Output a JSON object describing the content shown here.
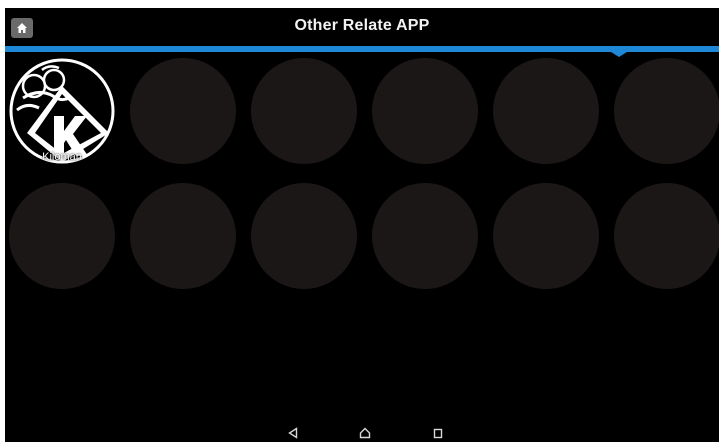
{
  "header": {
    "title": "Other Relate APP",
    "home_icon": "home-icon"
  },
  "apps": [
    {
      "label": "Kiloman",
      "icon": "kiloman-app-icon"
    }
  ],
  "empty_slots": 11,
  "navbar": {
    "back_icon": "back-triangle-icon",
    "home_icon": "home-outline-icon",
    "recents_icon": "recents-square-icon"
  },
  "colors": {
    "accent": "#1e88d6",
    "background": "#000000",
    "slot": "#1c1717"
  }
}
